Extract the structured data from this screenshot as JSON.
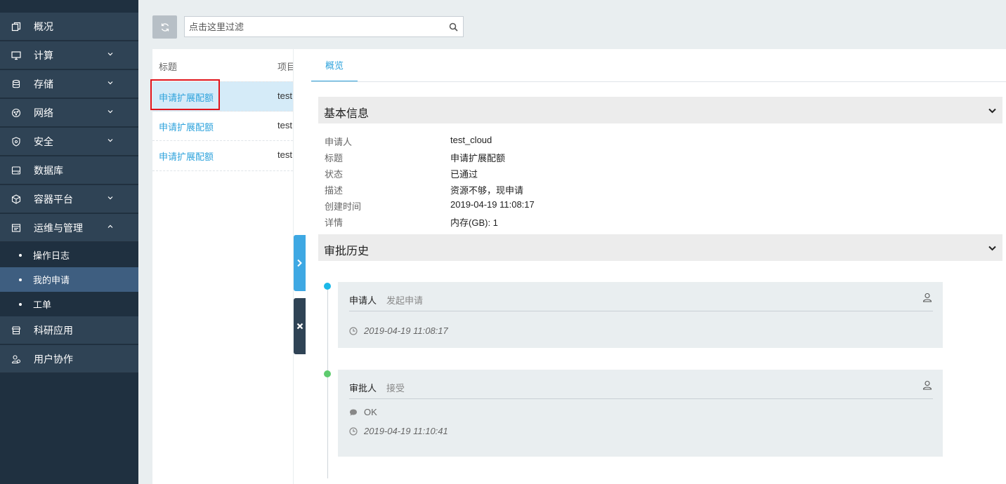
{
  "sidebar": {
    "items": [
      {
        "label": "概况",
        "icon": "overview-icon",
        "has_chevron": false
      },
      {
        "label": "计算",
        "icon": "monitor-icon",
        "has_chevron": true
      },
      {
        "label": "存储",
        "icon": "database-icon",
        "has_chevron": true
      },
      {
        "label": "网络",
        "icon": "network-icon",
        "has_chevron": true
      },
      {
        "label": "安全",
        "icon": "shield-icon",
        "has_chevron": true
      },
      {
        "label": "数据库",
        "icon": "db-drive-icon",
        "has_chevron": false
      },
      {
        "label": "容器平台",
        "icon": "container-icon",
        "has_chevron": true
      },
      {
        "label": "运维与管理",
        "icon": "ops-icon",
        "has_chevron": true,
        "expanded": true
      },
      {
        "label": "科研应用",
        "icon": "store-icon",
        "has_chevron": false
      },
      {
        "label": "用户协作",
        "icon": "users-icon",
        "has_chevron": false
      }
    ],
    "subitems": [
      {
        "label": "操作日志",
        "active": false
      },
      {
        "label": "我的申请",
        "active": true
      },
      {
        "label": "工单",
        "active": false
      }
    ]
  },
  "toolbar": {
    "search_placeholder": "点击这里过滤"
  },
  "list": {
    "columns": [
      "标题",
      "项目"
    ],
    "rows": [
      {
        "title": "申请扩展配额",
        "project": "test",
        "selected": true
      },
      {
        "title": "申请扩展配额",
        "project": "test",
        "selected": false
      },
      {
        "title": "申请扩展配额",
        "project": "test",
        "selected": false
      }
    ]
  },
  "detail": {
    "tab": "概览",
    "basic_info": {
      "title": "基本信息",
      "fields": [
        {
          "label": "申请人",
          "value": "test_cloud"
        },
        {
          "label": "标题",
          "value": "申请扩展配额"
        },
        {
          "label": "状态",
          "value": "已通过"
        },
        {
          "label": "描述",
          "value": "资源不够，现申请"
        },
        {
          "label": "创建时间",
          "value": "2019-04-19 11:08:17"
        },
        {
          "label": "详情",
          "value": "内存(GB): 1"
        }
      ]
    },
    "history": {
      "title": "审批历史",
      "entries": [
        {
          "role": "申请人",
          "action": "发起申请",
          "comment": "",
          "time": "2019-04-19 11:08:17",
          "dot_color": "#1cb8e8"
        },
        {
          "role": "审批人",
          "action": "接受",
          "comment": "OK",
          "time": "2019-04-19 11:10:41",
          "dot_color": "#5ecb6e"
        }
      ]
    }
  },
  "colors": {
    "accent": "#2fa3dc",
    "sidebar_bg": "#1f3040",
    "sidebar_item_bg": "#2f4355",
    "active_sub_bg": "#3e5e80",
    "highlight": "#e0141b"
  }
}
